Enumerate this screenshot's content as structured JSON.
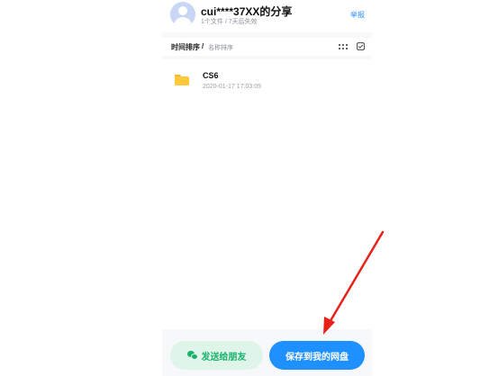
{
  "share": {
    "title": "cui****37XX的分享",
    "meta": "1个文件 / 7天后失效",
    "report_label": "举报"
  },
  "sort": {
    "active": "时间排序",
    "separator": "/",
    "other": "名称排序"
  },
  "files": [
    {
      "name": "CS6",
      "date": "2020-01-17 17:03:05",
      "icon": "folder-icon"
    }
  ],
  "actions": {
    "send_label": "发送给朋友",
    "save_label": "保存到我的网盘"
  },
  "colors": {
    "accent": "#1e90ff",
    "wechat_green": "#17b26a",
    "annotation_arrow": "#e8221b",
    "folder": "#ffc93a"
  }
}
